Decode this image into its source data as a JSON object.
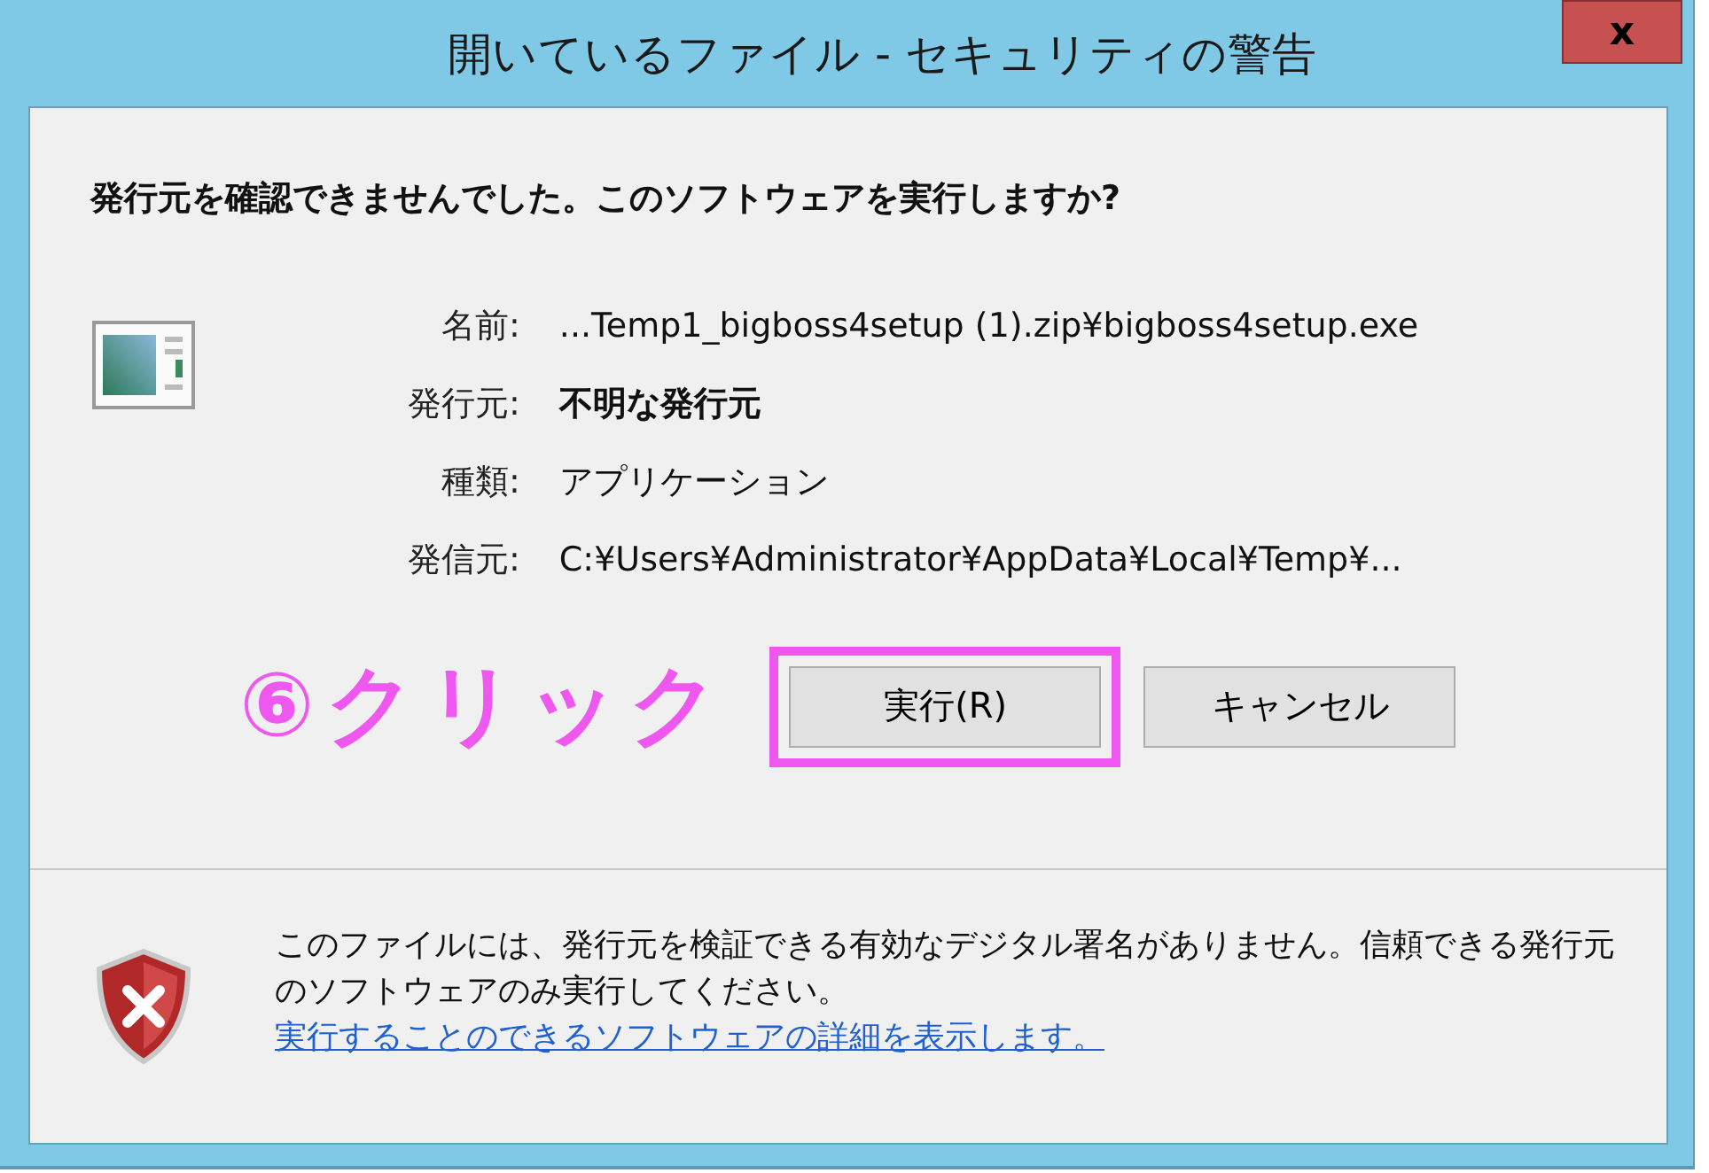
{
  "window": {
    "title": "開いているファイル - セキュリティの警告",
    "close": "x"
  },
  "heading": "発行元を確認できませんでした。このソフトウェアを実行しますか?",
  "fields": [
    {
      "label": "名前:",
      "value": "...Temp1_bigboss4setup (1).zip¥bigboss4setup.exe",
      "bold": false
    },
    {
      "label": "発行元:",
      "value": "不明な発行元",
      "bold": true
    },
    {
      "label": "種類:",
      "value": "アプリケーション",
      "bold": false
    },
    {
      "label": "発信元:",
      "value": "C:¥Users¥Administrator¥AppData¥Local¥Temp¥...",
      "bold": false
    }
  ],
  "annotation": {
    "text": "⑥クリック"
  },
  "buttons": [
    {
      "label": "実行(R)",
      "highlighted": true
    },
    {
      "label": "キャンセル",
      "highlighted": false
    }
  ],
  "footer": {
    "text": "このファイルには、発行元を検証できる有効なデジタル署名がありません。信頼できる発行元のソフトウェアのみ実行してください。",
    "link": "実行することのできるソフトウェアの詳細を表示します。"
  }
}
